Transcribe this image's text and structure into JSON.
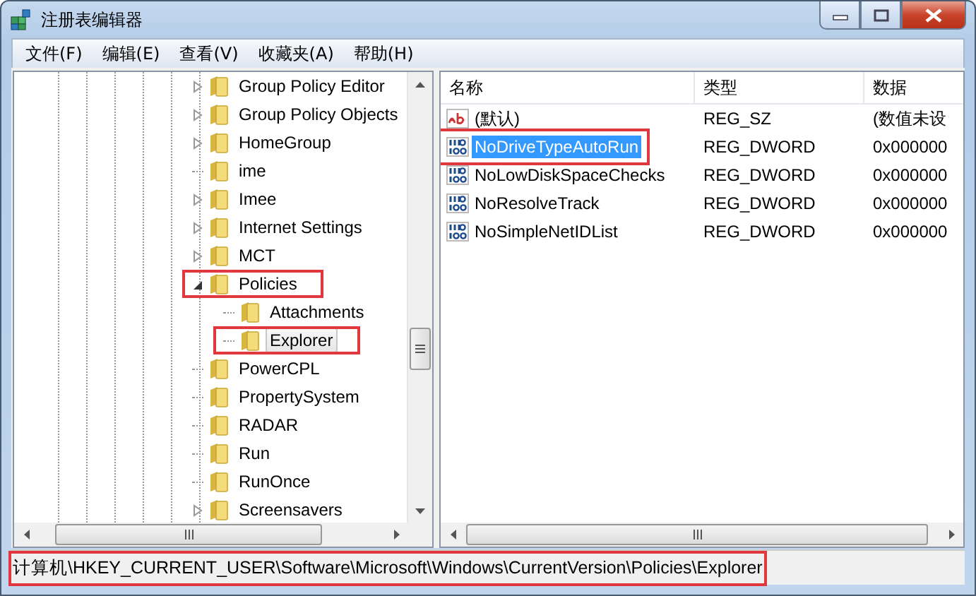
{
  "window": {
    "title": "注册表编辑器"
  },
  "menu": [
    "文件(F)",
    "编辑(E)",
    "查看(V)",
    "收藏夹(A)",
    "帮助(H)"
  ],
  "tree": [
    {
      "name": "Group Policy Editor",
      "kind": "collapsed",
      "selected": false,
      "highlighted": false
    },
    {
      "name": "Group Policy Objects",
      "kind": "collapsed",
      "selected": false,
      "highlighted": false
    },
    {
      "name": "HomeGroup",
      "kind": "collapsed",
      "selected": false,
      "highlighted": false
    },
    {
      "name": "ime",
      "kind": "leaf",
      "selected": false,
      "highlighted": false
    },
    {
      "name": "Imee",
      "kind": "collapsed",
      "selected": false,
      "highlighted": false
    },
    {
      "name": "Internet Settings",
      "kind": "collapsed",
      "selected": false,
      "highlighted": false
    },
    {
      "name": "MCT",
      "kind": "collapsed",
      "selected": false,
      "highlighted": false
    },
    {
      "name": "Policies",
      "kind": "expanded",
      "selected": false,
      "highlighted": true,
      "children": [
        {
          "name": "Attachments",
          "kind": "leaf",
          "selected": false,
          "highlighted": false
        },
        {
          "name": "Explorer",
          "kind": "leaf",
          "selected": true,
          "highlighted": true
        }
      ]
    },
    {
      "name": "PowerCPL",
      "kind": "leaf",
      "selected": false,
      "highlighted": false
    },
    {
      "name": "PropertySystem",
      "kind": "leaf",
      "selected": false,
      "highlighted": false
    },
    {
      "name": "RADAR",
      "kind": "leaf",
      "selected": false,
      "highlighted": false
    },
    {
      "name": "Run",
      "kind": "leaf",
      "selected": false,
      "highlighted": false
    },
    {
      "name": "RunOnce",
      "kind": "leaf",
      "selected": false,
      "highlighted": false
    },
    {
      "name": "Screensavers",
      "kind": "collapsed",
      "selected": false,
      "highlighted": false
    }
  ],
  "values": {
    "columns": [
      "名称",
      "类型",
      "数据"
    ],
    "rows": [
      {
        "kind": "string",
        "name": "(默认)",
        "type": "REG_SZ",
        "data": "(数值未设",
        "selected": false,
        "highlighted": false
      },
      {
        "kind": "dword",
        "name": "NoDriveTypeAutoRun",
        "type": "REG_DWORD",
        "data": "0x000000",
        "selected": true,
        "highlighted": true
      },
      {
        "kind": "dword",
        "name": "NoLowDiskSpaceChecks",
        "type": "REG_DWORD",
        "data": "0x000000",
        "selected": false,
        "highlighted": false
      },
      {
        "kind": "dword",
        "name": "NoResolveTrack",
        "type": "REG_DWORD",
        "data": "0x000000",
        "selected": false,
        "highlighted": false
      },
      {
        "kind": "dword",
        "name": "NoSimpleNetIDList",
        "type": "REG_DWORD",
        "data": "0x000000",
        "selected": false,
        "highlighted": false
      }
    ]
  },
  "status_bar": {
    "path": "计算机\\HKEY_CURRENT_USER\\Software\\Microsoft\\Windows\\CurrentVersion\\Policies\\Explorer",
    "highlighted": true
  }
}
